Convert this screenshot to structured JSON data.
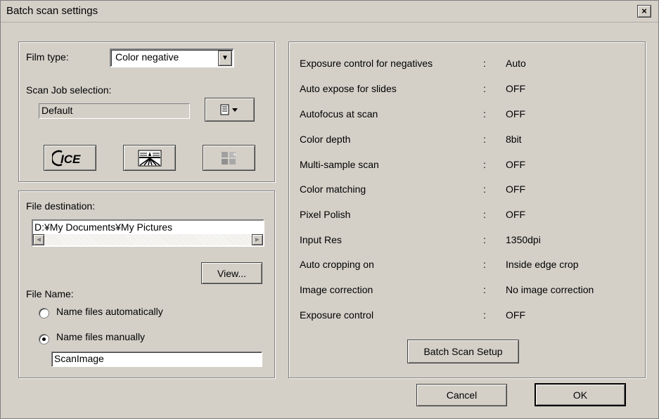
{
  "window": {
    "title": "Batch scan settings",
    "close_label": "×"
  },
  "film": {
    "label": "Film type:",
    "selected": "Color negative"
  },
  "scan_job": {
    "label": "Scan Job selection:",
    "value": "Default"
  },
  "icons": {
    "ice": "ICE",
    "job_menu": "job-menu-icon",
    "grain": "grain-dissolver-icon",
    "color_restore": "color-restore-icon"
  },
  "destination": {
    "label": "File destination:",
    "path": "D:¥My Documents¥My Pictures",
    "view_label": "View..."
  },
  "file_name": {
    "label": "File Name:",
    "auto_label": "Name files automatically",
    "manual_label": "Name files manually",
    "manual_selected": true,
    "value": "ScanImage"
  },
  "settings": [
    {
      "name": "Exposure control for negatives",
      "colon": ":",
      "value": "Auto"
    },
    {
      "name": "Auto expose for slides",
      "colon": ":",
      "value": "OFF"
    },
    {
      "name": "Autofocus at scan",
      "colon": ":",
      "value": "OFF"
    },
    {
      "name": "Color depth",
      "colon": ":",
      "value": "8bit"
    },
    {
      "name": "Multi-sample scan",
      "colon": ":",
      "value": "OFF"
    },
    {
      "name": "Color matching",
      "colon": ":",
      "value": "OFF"
    },
    {
      "name": "Pixel Polish",
      "colon": ":",
      "value": "OFF"
    },
    {
      "name": "Input Res",
      "colon": ":",
      "value": "1350dpi"
    },
    {
      "name": "Auto cropping on",
      "colon": ":",
      "value": "Inside edge crop"
    },
    {
      "name": "Image correction",
      "colon": ":",
      "value": "No image correction"
    },
    {
      "name": "Exposure control",
      "colon": ":",
      "value": "OFF"
    }
  ],
  "buttons": {
    "batch_setup": "Batch Scan Setup",
    "cancel": "Cancel",
    "ok": "OK"
  },
  "colors": {
    "dialog_bg": "#d4d0c8",
    "shadow": "#808080",
    "highlight": "#ffffff"
  }
}
